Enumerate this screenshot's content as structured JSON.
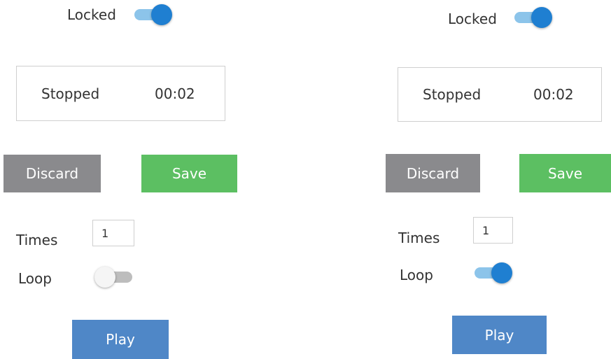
{
  "panels": [
    {
      "locked_label": "Locked",
      "locked_on": true,
      "status": "Stopped",
      "time": "00:02",
      "discard_label": "Discard",
      "save_label": "Save",
      "times_label": "Times",
      "times_value": "1",
      "loop_label": "Loop",
      "loop_on": false,
      "play_label": "Play"
    },
    {
      "locked_label": "Locked",
      "locked_on": true,
      "status": "Stopped",
      "time": "00:02",
      "discard_label": "Discard",
      "save_label": "Save",
      "times_label": "Times",
      "times_value": "1",
      "loop_label": "Loop",
      "loop_on": true,
      "play_label": "Play"
    }
  ],
  "colors": {
    "toggle_on_knob": "#1f7fd1",
    "toggle_on_track": "#8cc4ea",
    "toggle_off_track": "#bdbdbd",
    "discard_bg": "#8a8a8d",
    "save_bg": "#5cbf62",
    "play_bg": "#4f87c7"
  }
}
